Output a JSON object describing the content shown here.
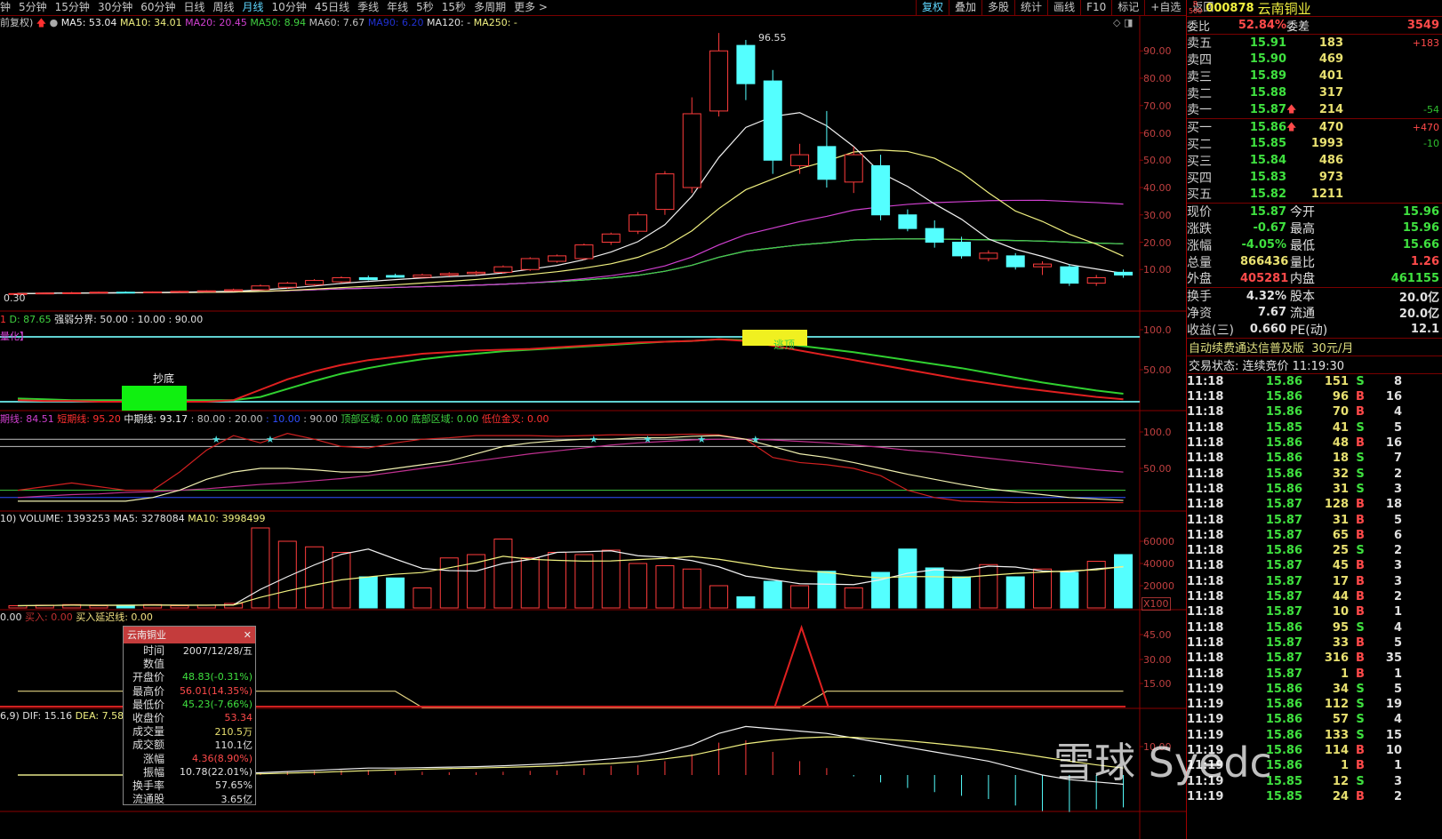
{
  "toolbar": {
    "periods": [
      "钟",
      "5分钟",
      "15分钟",
      "30分钟",
      "60分钟",
      "日线",
      "周线",
      "月线",
      "10分钟",
      "45日线",
      "季线",
      "年线",
      "5秒",
      "15秒",
      "多周期",
      "更多 >"
    ],
    "active_period": "月线",
    "actions": [
      "复权",
      "叠加",
      "多股",
      "统计",
      "画线",
      "F10",
      "标记",
      "+自选",
      "返回"
    ]
  },
  "main_legend": {
    "prefix": "前复权)",
    "ma5": "MA5: 53.04",
    "ma10": "MA10: 34.01",
    "ma20": "MA20: 20.45",
    "ma50": "MA50: 8.94",
    "ma60": "MA60: 7.67",
    "ma90": "MA90: 6.20",
    "ma120": "MA120: -",
    "ma250": "MA250: -",
    "high_label": "96.55",
    "low_label": "0.30"
  },
  "axes": {
    "main": [
      "90.00",
      "80.00",
      "70.00",
      "60.00",
      "50.00",
      "40.00",
      "30.00",
      "20.00",
      "10.00"
    ],
    "panel2": [
      "100.0",
      "50.00"
    ],
    "panel3": [
      "100.0",
      "50.00"
    ],
    "volume": [
      "60000",
      "40000",
      "20000"
    ],
    "volume_unit": "X100",
    "panel5": [
      "45.00",
      "30.00",
      "15.00"
    ],
    "macd": [
      "10.00"
    ]
  },
  "panel2": {
    "legend_d": "D: 87.65",
    "legend_rest": "强弱分界: 50.00 : 10.00 : 90.00",
    "tag": "量化】",
    "bottom_label": "抄底",
    "top_label": "逃顶"
  },
  "panel3": {
    "l1": "期线: 84.51",
    "l2": "短期线: 95.20",
    "l3": "中期线: 93.17",
    "l4": ": 80.00 : 20.00",
    "l5": ": 10.00",
    "l6": ": 90.00",
    "l7": "顶部区域: 0.00",
    "l8": "底部区域: 0.00",
    "l9": "低位金叉: 0.00"
  },
  "volume_legend": {
    "text": "10) VOLUME: 1393253",
    "ma5": "MA5: 3278084",
    "ma10": "MA10: 3998499"
  },
  "panel5": {
    "l1": "0.00",
    "l2": "买入: 0.00",
    "l3": "买入延迟线: 0.00"
  },
  "macd": {
    "legend": "6,9) DIF: 15.16",
    "dea": "DEA: 7.58"
  },
  "tooltip": {
    "title": "云南铜业",
    "rows": [
      {
        "k": "时间",
        "v": "2007/12/28/五",
        "c": "w"
      },
      {
        "k": "数值",
        "v": "",
        "c": "w"
      },
      {
        "k": "开盘价",
        "v": "48.83(-0.31%)",
        "c": "g"
      },
      {
        "k": "最高价",
        "v": "56.01(14.35%)",
        "c": "r"
      },
      {
        "k": "最低价",
        "v": "45.23(-7.66%)",
        "c": "g"
      },
      {
        "k": "收盘价",
        "v": "53.34",
        "c": "r"
      },
      {
        "k": "成交量",
        "v": "210.5万",
        "c": "y"
      },
      {
        "k": "成交额",
        "v": "110.1亿",
        "c": "w"
      },
      {
        "k": "涨幅",
        "v": "4.36(8.90%)",
        "c": "r"
      },
      {
        "k": "振幅",
        "v": "10.78(22.01%)",
        "c": "w"
      },
      {
        "k": "换手率",
        "v": "57.65%",
        "c": "w"
      },
      {
        "k": "流通股",
        "v": "3.65亿",
        "c": "w"
      }
    ]
  },
  "quote": {
    "badge_top": "R",
    "badge_bottom": "500",
    "code": "000878",
    "name": "云南铜业",
    "wb_label": "委比",
    "wb": "52.84%",
    "wc_label": "委差",
    "wc": "3549",
    "asks": [
      {
        "k": "卖五",
        "p": "15.91",
        "v": "183",
        "d": "+183",
        "dc": "r",
        "up": false
      },
      {
        "k": "卖四",
        "p": "15.90",
        "v": "469",
        "d": "",
        "dc": "r",
        "up": false
      },
      {
        "k": "卖三",
        "p": "15.89",
        "v": "401",
        "d": "",
        "dc": "r",
        "up": false
      },
      {
        "k": "卖二",
        "p": "15.88",
        "v": "317",
        "d": "",
        "dc": "r",
        "up": false
      },
      {
        "k": "卖一",
        "p": "15.87",
        "v": "214",
        "d": "-54",
        "dc": "dg",
        "up": true
      }
    ],
    "bids": [
      {
        "k": "买一",
        "p": "15.86",
        "v": "470",
        "d": "+470",
        "dc": "r",
        "up": true
      },
      {
        "k": "买二",
        "p": "15.85",
        "v": "1993",
        "d": "-10",
        "dc": "dg",
        "up": false
      },
      {
        "k": "买三",
        "p": "15.84",
        "v": "486",
        "d": "",
        "dc": "r",
        "up": false
      },
      {
        "k": "买四",
        "p": "15.83",
        "v": "973",
        "d": "",
        "dc": "r",
        "up": false
      },
      {
        "k": "买五",
        "p": "15.82",
        "v": "1211",
        "d": "",
        "dc": "r",
        "up": false
      }
    ],
    "stats": [
      {
        "k1": "现价",
        "v1": "15.87",
        "c1": "g",
        "k2": "今开",
        "v2": "15.96",
        "c2": "g"
      },
      {
        "k1": "涨跌",
        "v1": "-0.67",
        "c1": "g",
        "k2": "最高",
        "v2": "15.96",
        "c2": "g"
      },
      {
        "k1": "涨幅",
        "v1": "-4.05%",
        "c1": "g",
        "k2": "最低",
        "v2": "15.66",
        "c2": "g"
      },
      {
        "k1": "总量",
        "v1": "866436",
        "c1": "y",
        "k2": "量比",
        "v2": "1.26",
        "c2": "r"
      },
      {
        "k1": "外盘",
        "v1": "405281",
        "c1": "r",
        "k2": "内盘",
        "v2": "461155",
        "c2": "g"
      }
    ],
    "stats2": [
      {
        "k1": "换手",
        "v1": "4.32%",
        "c1": "w",
        "k2": "股本",
        "v2": "20.0亿",
        "c2": "w"
      },
      {
        "k1": "净资",
        "v1": "7.67",
        "c1": "w",
        "k2": "流通",
        "v2": "20.0亿",
        "c2": "w"
      },
      {
        "k1": "收益(三)",
        "v1": "0.660",
        "c1": "w",
        "k2": "PE(动)",
        "v2": "12.1",
        "c2": "w"
      }
    ],
    "promo": "自动续费通达信普及版",
    "promo_price": "30元/月",
    "status": "交易状态: 连续竞价 11:19:30"
  },
  "trades": [
    [
      "11:18",
      "15.86",
      "151",
      "S",
      "8"
    ],
    [
      "11:18",
      "15.86",
      "96",
      "B",
      "16"
    ],
    [
      "11:18",
      "15.86",
      "70",
      "B",
      "4"
    ],
    [
      "11:18",
      "15.85",
      "41",
      "S",
      "5"
    ],
    [
      "11:18",
      "15.86",
      "48",
      "B",
      "16"
    ],
    [
      "11:18",
      "15.86",
      "18",
      "S",
      "7"
    ],
    [
      "11:18",
      "15.86",
      "32",
      "S",
      "2"
    ],
    [
      "11:18",
      "15.86",
      "31",
      "S",
      "3"
    ],
    [
      "11:18",
      "15.87",
      "128",
      "B",
      "18"
    ],
    [
      "11:18",
      "15.87",
      "31",
      "B",
      "5"
    ],
    [
      "11:18",
      "15.87",
      "65",
      "B",
      "6"
    ],
    [
      "11:18",
      "15.86",
      "25",
      "S",
      "2"
    ],
    [
      "11:18",
      "15.87",
      "45",
      "B",
      "3"
    ],
    [
      "11:18",
      "15.87",
      "17",
      "B",
      "3"
    ],
    [
      "11:18",
      "15.87",
      "44",
      "B",
      "2"
    ],
    [
      "11:18",
      "15.87",
      "10",
      "B",
      "1"
    ],
    [
      "11:18",
      "15.86",
      "95",
      "S",
      "4"
    ],
    [
      "11:18",
      "15.87",
      "33",
      "B",
      "5"
    ],
    [
      "11:18",
      "15.87",
      "316",
      "B",
      "35"
    ],
    [
      "11:18",
      "15.87",
      "1",
      "B",
      "1"
    ],
    [
      "11:19",
      "15.86",
      "34",
      "S",
      "5"
    ],
    [
      "11:19",
      "15.86",
      "112",
      "S",
      "19"
    ],
    [
      "11:19",
      "15.86",
      "57",
      "S",
      "4"
    ],
    [
      "11:19",
      "15.86",
      "133",
      "S",
      "15"
    ],
    [
      "11:19",
      "15.86",
      "114",
      "B",
      "10"
    ],
    [
      "11:19",
      "15.86",
      "1",
      "B",
      "1"
    ],
    [
      "11:19",
      "15.85",
      "12",
      "S",
      "3"
    ],
    [
      "11:19",
      "15.85",
      "24",
      "B",
      "2"
    ]
  ],
  "watermark": "雪球  Syedc",
  "colors": {
    "up": "#ff3c3c",
    "down": "#54ffff",
    "grid": "#8a0000",
    "ma5": "#f0f0f0",
    "ma10": "#f0f080",
    "ma20": "#d040d0",
    "ma50": "#40d040",
    "ma60": "#c0c0c0",
    "ma90": "#2020d0"
  },
  "chart_data": {
    "type": "candlestick",
    "ylim": [
      0,
      100
    ],
    "ohlc": [
      [
        1,
        1.5,
        0.8,
        1.2
      ],
      [
        1.2,
        1.6,
        1,
        1.4
      ],
      [
        1.4,
        1.8,
        1.2,
        1.5
      ],
      [
        1.5,
        1.9,
        1.3,
        1.7
      ],
      [
        1.7,
        2,
        1.4,
        1.6
      ],
      [
        1.6,
        2,
        1.4,
        1.8
      ],
      [
        1.8,
        2.2,
        1.5,
        2
      ],
      [
        2,
        2.4,
        1.8,
        2.2
      ],
      [
        2.2,
        3,
        2,
        2.6
      ],
      [
        2.6,
        4.5,
        2.4,
        4
      ],
      [
        3.5,
        5.5,
        3,
        5
      ],
      [
        4.5,
        6.5,
        4,
        6
      ],
      [
        5.5,
        7.5,
        5,
        7
      ],
      [
        7,
        7.8,
        6,
        6.3
      ],
      [
        7.8,
        8.5,
        7,
        7.2
      ],
      [
        7.2,
        8.5,
        7,
        8
      ],
      [
        8,
        9,
        7.5,
        8.5
      ],
      [
        8.5,
        9.5,
        8,
        9
      ],
      [
        9,
        11.5,
        8.5,
        11
      ],
      [
        10,
        14.5,
        9.5,
        14
      ],
      [
        13,
        15.5,
        12.5,
        15
      ],
      [
        14,
        19.5,
        13.5,
        19
      ],
      [
        20,
        23.5,
        19,
        23
      ],
      [
        24,
        31,
        23,
        30
      ],
      [
        32,
        46,
        30,
        45
      ],
      [
        40,
        73,
        38,
        67
      ],
      [
        68,
        96.55,
        66,
        90
      ],
      [
        92,
        94,
        72,
        78
      ],
      [
        79,
        83,
        45,
        50
      ],
      [
        48,
        56,
        45,
        52
      ],
      [
        55,
        68,
        40,
        43
      ],
      [
        42,
        55,
        38,
        52
      ],
      [
        48,
        52,
        28,
        30
      ],
      [
        30,
        32,
        24,
        25
      ],
      [
        25,
        28,
        18,
        20
      ],
      [
        20,
        22,
        14,
        15
      ],
      [
        14,
        17,
        13,
        16
      ],
      [
        15,
        16,
        10,
        11
      ],
      [
        11,
        13,
        8,
        12
      ],
      [
        11,
        12,
        4,
        5
      ],
      [
        5,
        8,
        4,
        7
      ],
      [
        9,
        10,
        7,
        8
      ]
    ],
    "volume_x100": [
      2000,
      2500,
      3000,
      2000,
      2500,
      3000,
      2000,
      2500,
      4000,
      72000,
      60000,
      55000,
      50000,
      28000,
      27000,
      18000,
      45000,
      48000,
      62000,
      45000,
      50000,
      48000,
      52000,
      40000,
      38000,
      35000,
      20000,
      10000,
      24000,
      20000,
      33000,
      18000,
      32000,
      53000,
      36000,
      28000,
      39000,
      28000,
      35000,
      32000,
      42000,
      48000
    ],
    "panel2_red": [
      12,
      11,
      11,
      10,
      10,
      10,
      10,
      10,
      12,
      25,
      38,
      48,
      56,
      62,
      66,
      70,
      72,
      74,
      75,
      76,
      78,
      80,
      82,
      84,
      85,
      86,
      88,
      86,
      80,
      74,
      68,
      62,
      56,
      50,
      44,
      38,
      33,
      28,
      24,
      20,
      16,
      13
    ],
    "panel2_green": [
      14,
      13,
      12,
      12,
      12,
      12,
      12,
      12,
      12,
      16,
      26,
      36,
      45,
      52,
      58,
      63,
      67,
      70,
      73,
      75,
      77,
      79,
      81,
      83,
      85,
      86,
      88,
      87,
      84,
      80,
      76,
      72,
      67,
      62,
      57,
      52,
      46,
      40,
      34,
      29,
      24,
      20
    ],
    "panel3_white": [
      5,
      5,
      5,
      5,
      5,
      10,
      20,
      35,
      45,
      50,
      50,
      48,
      45,
      45,
      50,
      55,
      60,
      70,
      80,
      85,
      88,
      90,
      90,
      92,
      92,
      94,
      95,
      90,
      80,
      70,
      65,
      58,
      50,
      42,
      35,
      28,
      22,
      18,
      14,
      10,
      8,
      6
    ],
    "panel3_red": [
      20,
      25,
      30,
      25,
      20,
      20,
      45,
      75,
      95,
      85,
      98,
      90,
      80,
      78,
      85,
      90,
      92,
      95,
      95,
      95,
      94,
      95,
      96,
      96,
      96,
      97,
      96,
      90,
      65,
      58,
      55,
      50,
      40,
      20,
      10,
      5,
      4,
      3,
      3,
      3,
      3,
      3
    ],
    "panel3_magenta": [
      10,
      12,
      14,
      15,
      17,
      18,
      20,
      22,
      25,
      28,
      30,
      33,
      36,
      40,
      45,
      50,
      55,
      60,
      65,
      70,
      74,
      78,
      82,
      85,
      87,
      89,
      90,
      90,
      89,
      87,
      85,
      82,
      79,
      75,
      72,
      68,
      64,
      60,
      56,
      52,
      48,
      45
    ],
    "panel5_yellow": [
      10,
      10,
      10,
      10,
      10,
      10,
      10,
      10,
      10,
      10,
      10,
      10,
      10,
      10,
      10,
      0,
      0,
      0,
      0,
      0,
      0,
      0,
      0,
      0,
      0,
      0,
      0,
      0,
      0,
      0,
      10,
      10,
      10,
      10,
      10,
      10,
      10,
      10,
      10,
      10,
      10,
      10
    ],
    "macd_dif": [
      0,
      0,
      0,
      0,
      0,
      0,
      0.2,
      0.4,
      0.6,
      1,
      1.5,
      2,
      2.5,
      3,
      3,
      3.2,
      3.4,
      3.6,
      4,
      4.5,
      5,
      6,
      7,
      8,
      10,
      13,
      18,
      21,
      20,
      19,
      18,
      16,
      14,
      12,
      10,
      8,
      6,
      3,
      0,
      -2,
      -3,
      -4
    ],
    "macd_dea": [
      0,
      0,
      0,
      0,
      0,
      0,
      0.1,
      0.2,
      0.3,
      0.5,
      0.8,
      1.1,
      1.5,
      1.9,
      2.2,
      2.5,
      2.8,
      3,
      3.3,
      3.6,
      4,
      4.5,
      5,
      5.8,
      7,
      8.5,
      11,
      13.5,
      15,
      16,
      16.5,
      16.3,
      15.6,
      14.8,
      13.7,
      12.5,
      11.2,
      9.6,
      7.8,
      6,
      4.4,
      3
    ]
  }
}
